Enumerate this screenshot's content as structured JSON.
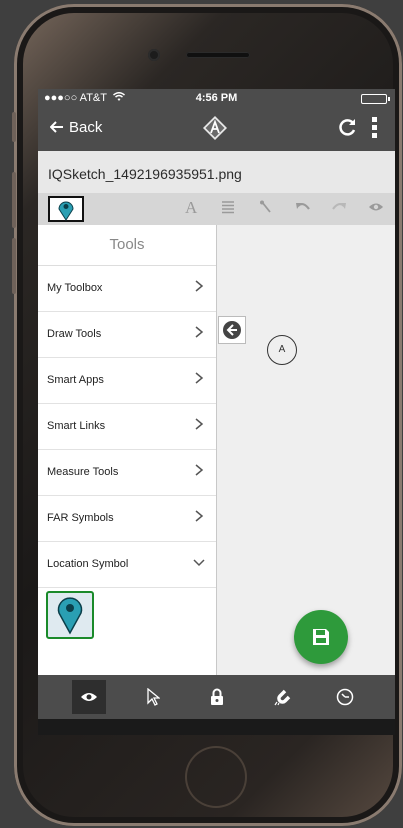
{
  "status_bar": {
    "carrier": "●●●○○ AT&T",
    "time": "4:56 PM"
  },
  "nav": {
    "back_label": "Back"
  },
  "file": {
    "name": "IQSketch_1492196935951.png"
  },
  "toolbar": {
    "text_tool_label": "A"
  },
  "tools_panel": {
    "title": "Tools",
    "items": [
      {
        "label": "My Toolbox",
        "state": "collapsed"
      },
      {
        "label": "Draw Tools",
        "state": "collapsed"
      },
      {
        "label": "Smart Apps",
        "state": "collapsed"
      },
      {
        "label": "Smart Links",
        "state": "collapsed"
      },
      {
        "label": "Measure Tools",
        "state": "collapsed"
      },
      {
        "label": "FAR Symbols",
        "state": "collapsed"
      },
      {
        "label": "Location Symbol",
        "state": "expanded"
      }
    ]
  },
  "canvas": {
    "marker_label": "A"
  },
  "colors": {
    "bar": "#4c4c4c",
    "accent": "#2e9a3b",
    "pin": "#2a9fb3"
  },
  "bottom_bar": {
    "items": [
      {
        "icon": "eye-icon",
        "active": true
      },
      {
        "icon": "pointer-icon",
        "active": false
      },
      {
        "icon": "lock-icon",
        "active": false
      },
      {
        "icon": "magnet-icon",
        "active": false
      },
      {
        "icon": "clock-icon",
        "active": false
      }
    ]
  }
}
